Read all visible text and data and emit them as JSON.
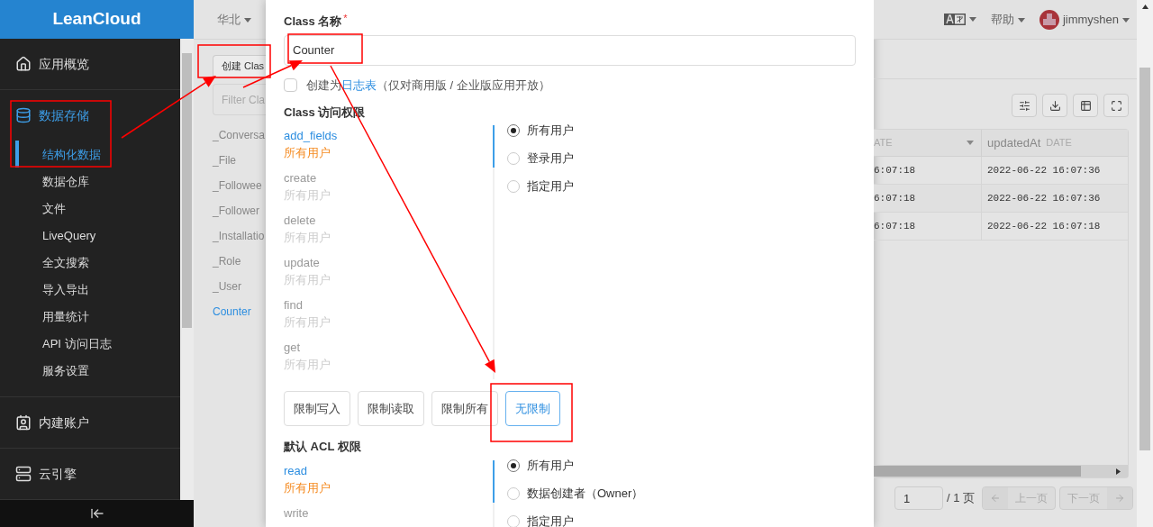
{
  "sidebar": {
    "logo": "LeanCloud",
    "sections": [
      {
        "label": "应用概览",
        "selected": false
      },
      {
        "label": "数据存储",
        "selected": true,
        "children": [
          {
            "label": "结构化数据",
            "selected": true
          },
          {
            "label": "数据仓库",
            "selected": false
          },
          {
            "label": "文件",
            "selected": false
          },
          {
            "label": "LiveQuery",
            "selected": false
          },
          {
            "label": "全文搜索",
            "selected": false
          },
          {
            "label": "导入导出",
            "selected": false
          },
          {
            "label": "用量统计",
            "selected": false
          },
          {
            "label": "API 访问日志",
            "selected": false
          },
          {
            "label": "服务设置",
            "selected": false
          }
        ]
      },
      {
        "label": "内建账户",
        "selected": false
      },
      {
        "label": "云引擎",
        "selected": false
      }
    ]
  },
  "topbar": {
    "region": "华北",
    "help": "帮助",
    "user": "jimmyshen"
  },
  "class_panel": {
    "create_button": "创建 Clas",
    "filter_placeholder": "Filter Cla",
    "classes": [
      {
        "name": "_Conversa",
        "selected": false
      },
      {
        "name": "_File",
        "selected": false
      },
      {
        "name": "_Followee",
        "selected": false
      },
      {
        "name": "_Follower",
        "selected": false
      },
      {
        "name": "_Installatio",
        "selected": false
      },
      {
        "name": "_Role",
        "selected": false
      },
      {
        "name": "_User",
        "selected": false
      },
      {
        "name": "Counter",
        "selected": true
      }
    ]
  },
  "dialog": {
    "name_label": "Class 名称",
    "required_mark": "*",
    "name_value": "Counter",
    "log_table": {
      "checked": false,
      "prefix": "创建为",
      "link": "日志表",
      "suffix": "（仅对商用版 / 企业版应用开放）"
    },
    "class_permissions": {
      "title": "Class 访问权限",
      "items": [
        {
          "name": "add_fields",
          "value": "所有用户",
          "selected": true
        },
        {
          "name": "create",
          "value": "所有用户",
          "selected": false
        },
        {
          "name": "delete",
          "value": "所有用户",
          "selected": false
        },
        {
          "name": "update",
          "value": "所有用户",
          "selected": false
        },
        {
          "name": "find",
          "value": "所有用户",
          "selected": false
        },
        {
          "name": "get",
          "value": "所有用户",
          "selected": false
        }
      ],
      "options": [
        {
          "label": "所有用户",
          "selected": true
        },
        {
          "label": "登录用户",
          "selected": false
        },
        {
          "label": "指定用户",
          "selected": false
        }
      ]
    },
    "presets": [
      {
        "label": "限制写入",
        "selected": false
      },
      {
        "label": "限制读取",
        "selected": false
      },
      {
        "label": "限制所有",
        "selected": false
      },
      {
        "label": "无限制",
        "selected": true
      }
    ],
    "acl_permissions": {
      "title": "默认 ACL 权限",
      "items": [
        {
          "name": "read",
          "value": "所有用户",
          "selected": true
        },
        {
          "name": "write",
          "selected": false
        }
      ],
      "options": [
        {
          "label": "所有用户",
          "selected": true
        },
        {
          "label": "数据创建者（Owner）",
          "selected": false
        },
        {
          "label": "指定用户",
          "selected": false
        }
      ]
    }
  },
  "table": {
    "columns": [
      {
        "type": "ATE",
        "sortable": true
      },
      {
        "name": "updatedAt",
        "type": "DATE",
        "sortable": false
      }
    ],
    "rows": [
      [
        "6:07:18",
        "2022-06-22 16:07:36"
      ],
      [
        "6:07:18",
        "2022-06-22 16:07:36"
      ],
      [
        "6:07:18",
        "2022-06-22 16:07:18"
      ]
    ]
  },
  "pagination": {
    "page": "1",
    "total": "/ 1 页",
    "prev": "上一页",
    "next": "下一页"
  }
}
